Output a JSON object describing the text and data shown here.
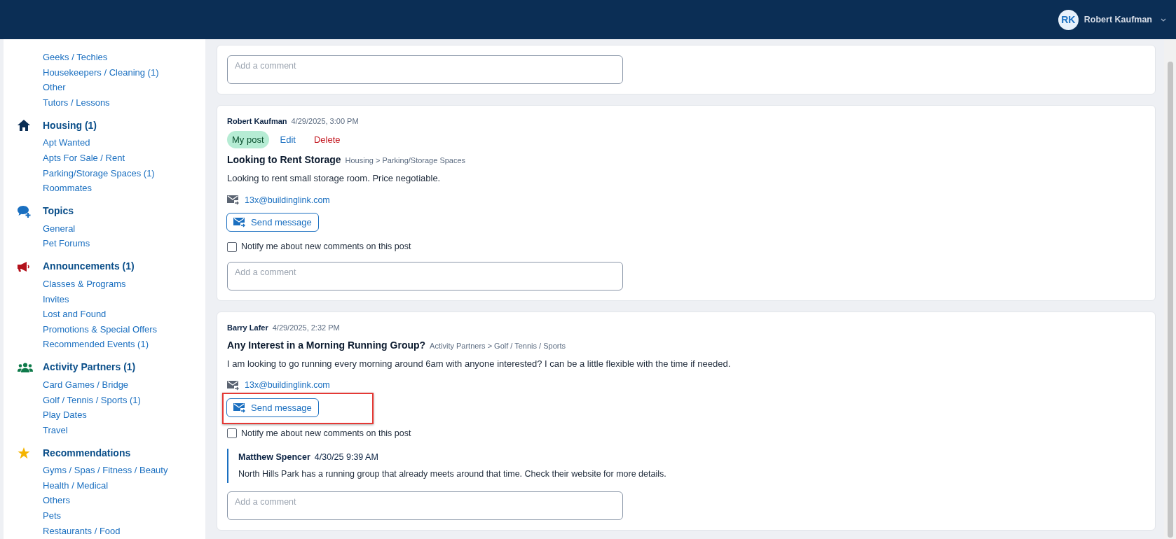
{
  "header": {
    "user": {
      "initials": "RK",
      "name": "Robert Kaufman"
    }
  },
  "sidebar": {
    "groups": [
      {
        "items": [
          "Geeks / Techies",
          "Housekeepers / Cleaning (1)",
          "Other",
          "Tutors / Lessons"
        ]
      },
      {
        "kind": "housing",
        "title": "Housing (1)",
        "items": [
          "Apt Wanted",
          "Apts For Sale / Rent",
          "Parking/Storage Spaces (1)",
          "Roommates"
        ]
      },
      {
        "kind": "topics",
        "title": "Topics",
        "items": [
          "General",
          "Pet Forums"
        ]
      },
      {
        "kind": "announcements",
        "title": "Announcements (1)",
        "items": [
          "Classes & Programs",
          "Invites",
          "Lost and Found",
          "Promotions & Special Offers",
          "Recommended Events (1)"
        ]
      },
      {
        "kind": "activity",
        "title": "Activity Partners (1)",
        "items": [
          "Card Games / Bridge",
          "Golf / Tennis / Sports (1)",
          "Play Dates",
          "Travel"
        ]
      },
      {
        "kind": "recommendations",
        "title": "Recommendations",
        "items": [
          "Gyms / Spas / Fitness / Beauty",
          "Health / Medical",
          "Others",
          "Pets",
          "Restaurants / Food"
        ]
      }
    ]
  },
  "posts": [
    {
      "comment_placeholder": "Add a comment"
    },
    {
      "author": "Robert Kaufman",
      "date": "4/29/2025, 3:00 PM",
      "badge": "My post",
      "edit": "Edit",
      "delete": "Delete",
      "title": "Looking to Rent Storage",
      "category": "Housing > Parking/Storage Spaces",
      "body": "Looking to rent small storage room. Price negotiable.",
      "email": "13x@buildinglink.com",
      "send_label": "Send message",
      "highlighted": false,
      "notify": {
        "label": "Notify me about new comments on this post",
        "checked": false
      },
      "comment_placeholder": "Add a comment"
    },
    {
      "author": "Barry Lafer",
      "date": "4/29/2025, 2:32 PM",
      "title": "Any Interest in a Morning Running Group?",
      "category": "Activity Partners > Golf / Tennis / Sports",
      "body": "I am looking to go running every morning around 6am with anyone interested? I can be a little flexible with the time if needed.",
      "email": "13x@buildinglink.com",
      "send_label": "Send message",
      "highlighted": true,
      "notify": {
        "label": "Notify me about new comments on this post",
        "checked": false
      },
      "replies": [
        {
          "author": "Matthew Spencer",
          "date": "4/30/25 9:39 AM",
          "text": "North Hills Park has a running group that already meets around that time. Check their website for more details."
        }
      ],
      "comment_placeholder": "Add a comment"
    }
  ]
}
